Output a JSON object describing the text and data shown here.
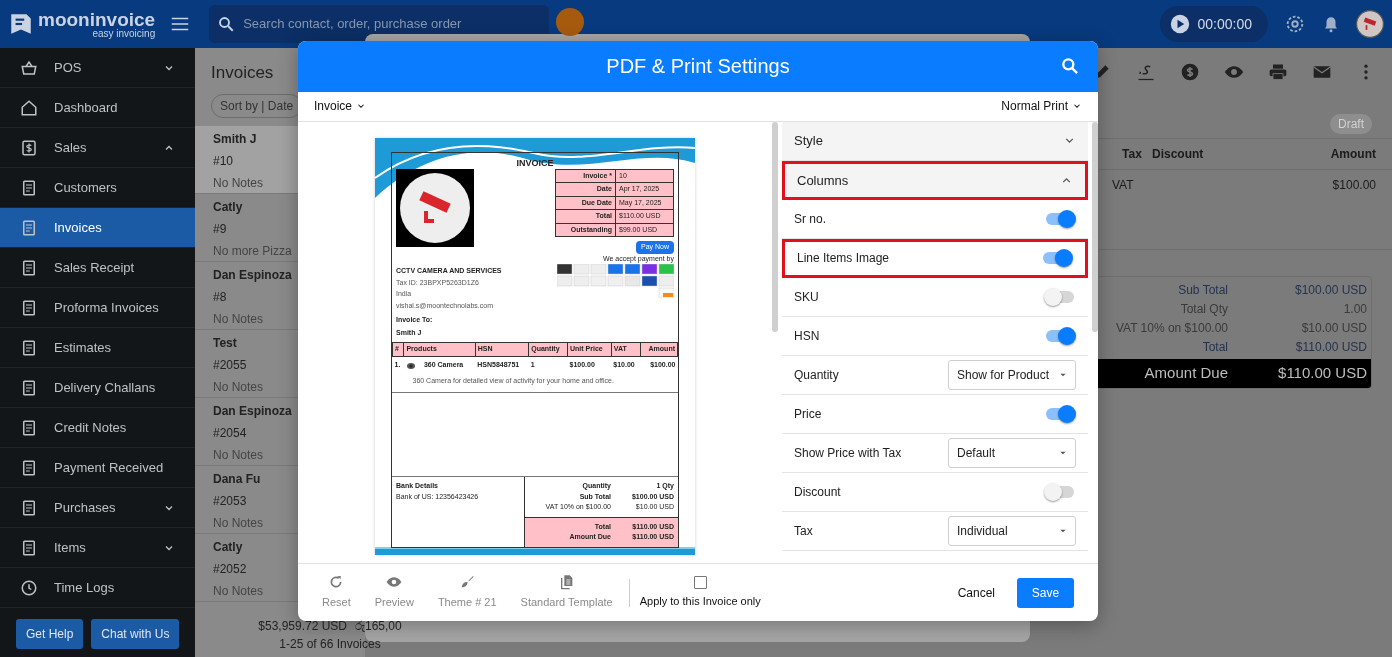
{
  "app": {
    "logo_title": "mooninvoice",
    "logo_tagline": "easy invoicing",
    "search_placeholder": "Search contact, order, purchase order",
    "timer": "00:00:00"
  },
  "sidebar": {
    "items": [
      {
        "label": "POS",
        "kind": "group",
        "expanded": false,
        "selected": false
      },
      {
        "label": "Dashboard",
        "kind": "link",
        "selected": false
      },
      {
        "label": "Sales",
        "kind": "group",
        "expanded": true,
        "selected": false
      },
      {
        "label": "Customers",
        "kind": "link",
        "selected": false
      },
      {
        "label": "Invoices",
        "kind": "link",
        "selected": true
      },
      {
        "label": "Sales Receipt",
        "kind": "link",
        "selected": false
      },
      {
        "label": "Proforma Invoices",
        "kind": "link",
        "selected": false
      },
      {
        "label": "Estimates",
        "kind": "link",
        "selected": false
      },
      {
        "label": "Delivery Challans",
        "kind": "link",
        "selected": false
      },
      {
        "label": "Credit Notes",
        "kind": "link",
        "selected": false
      },
      {
        "label": "Payment Received",
        "kind": "link",
        "selected": false
      },
      {
        "label": "Purchases",
        "kind": "group",
        "expanded": false,
        "selected": false
      },
      {
        "label": "Items",
        "kind": "group",
        "expanded": false,
        "selected": false
      },
      {
        "label": "Time Logs",
        "kind": "link",
        "selected": false
      }
    ],
    "buttons": [
      "Get Help",
      "Chat with Us"
    ]
  },
  "invoice_list": {
    "title": "Invoices",
    "sort": "Sort by | Date",
    "items": [
      {
        "name": "Smith J",
        "number": "#10",
        "note": "No Notes",
        "selected": true
      },
      {
        "name": "Catly",
        "number": "#9",
        "note": "No more Pizza",
        "selected": false
      },
      {
        "name": "Dan Espinoza",
        "number": "#8",
        "note": "No Notes",
        "selected": false
      },
      {
        "name": "Test",
        "number": "#2055",
        "note": "No Notes",
        "selected": false
      },
      {
        "name": "Dan Espinoza",
        "number": "#2054",
        "note": "No Notes",
        "selected": false
      },
      {
        "name": "Dana Fu",
        "number": "#2053",
        "note": "No Notes",
        "selected": false
      },
      {
        "name": "Catly",
        "number": "#2052",
        "note": "No Notes",
        "selected": false
      }
    ],
    "footer_total": "$53,959.72 USD",
    "footer_total_2": "රු165,00",
    "pagination": "1-25 of 66 Invoices"
  },
  "detail": {
    "status": "Draft",
    "columns": [
      "Tax",
      "Discount",
      "Amount"
    ],
    "row": {
      "tax": "VAT",
      "amount": "$100.00"
    },
    "totals": [
      {
        "label": "Sub Total",
        "value": "$100.00 USD"
      },
      {
        "label": "Total Qty",
        "value": "1.00"
      },
      {
        "label": "VAT 10% on $100.00",
        "value": "$10.00 USD"
      },
      {
        "label": "Total",
        "value": "$110.00 USD"
      }
    ],
    "amount_due": {
      "label": "Amount Due",
      "value": "$110.00 USD"
    }
  },
  "dialog": {
    "title": "PDF & Print Settings",
    "document_type": "Invoice",
    "print_mode": "Normal Print",
    "preview": {
      "heading": "INVOICE",
      "meta": [
        {
          "label": "Invoice *",
          "value": "10"
        },
        {
          "label": "Date",
          "value": "Apr 17, 2025"
        },
        {
          "label": "Due Date",
          "value": "May 17, 2025"
        },
        {
          "label": "Total",
          "value": "$110.00 USD"
        },
        {
          "label": "Outstanding",
          "value": "$99.00 USD"
        }
      ],
      "pay_button": "Pay Now",
      "accept_note": "We accept payment by",
      "company": "CCTV CAMERA AND SERVICES",
      "company_lines": [
        "Tax ID: 23BPXP5263D1Z6",
        "India",
        "vishal.s@moontechnolabs.com"
      ],
      "bill_to_label": "Invoice To:",
      "bill_to": "Smith J",
      "columns": [
        "#",
        "Products",
        "HSN",
        "Quantity",
        "Unit Price",
        "VAT",
        "Amount"
      ],
      "items": [
        {
          "number": "1.",
          "product": "360 Camera",
          "hsn": "HSN5848751",
          "quantity": "1",
          "unit_price": "$100.00",
          "vat": "$10.00",
          "amount": "$100.00",
          "description": "360 Camera for detailed view of activity for your home and office."
        }
      ],
      "bank_title": "Bank Details",
      "bank_line": "Bank of US: 12356423426",
      "summary": [
        {
          "label": "Quantity",
          "value": "1 Qty"
        },
        {
          "label": "Sub Total",
          "value": "$100.00 USD"
        },
        {
          "label": "VAT 10% on $100.00",
          "value": "$10.00 USD"
        }
      ],
      "totals": [
        {
          "label": "Total",
          "value": "$110.00 USD"
        },
        {
          "label": "Amount Due",
          "value": "$110.00 USD"
        }
      ]
    },
    "settings": [
      {
        "kind": "section",
        "label": "Style",
        "expanded": false,
        "highlighted": false
      },
      {
        "kind": "section",
        "label": "Columns",
        "expanded": true,
        "highlighted": true
      },
      {
        "kind": "toggle",
        "label": "Sr no.",
        "on": true,
        "highlighted": false
      },
      {
        "kind": "toggle",
        "label": "Line Items Image",
        "on": true,
        "highlighted": true
      },
      {
        "kind": "toggle",
        "label": "SKU",
        "on": false,
        "highlighted": false
      },
      {
        "kind": "toggle",
        "label": "HSN",
        "on": true,
        "highlighted": false
      },
      {
        "kind": "select",
        "label": "Quantity",
        "value": "Show for Product",
        "highlighted": false
      },
      {
        "kind": "toggle",
        "label": "Price",
        "on": true,
        "highlighted": false
      },
      {
        "kind": "select",
        "label": "Show Price with Tax",
        "value": "Default",
        "highlighted": false
      },
      {
        "kind": "toggle",
        "label": "Discount",
        "on": false,
        "highlighted": false
      },
      {
        "kind": "select",
        "label": "Tax",
        "value": "Individual",
        "highlighted": false
      }
    ],
    "footer_tools": [
      "Reset",
      "Preview",
      "Theme # 21",
      "Standard Template"
    ],
    "apply_only": {
      "label": "Apply to this Invoice only",
      "checked": false
    },
    "buttons": [
      "Cancel",
      "Save"
    ]
  }
}
